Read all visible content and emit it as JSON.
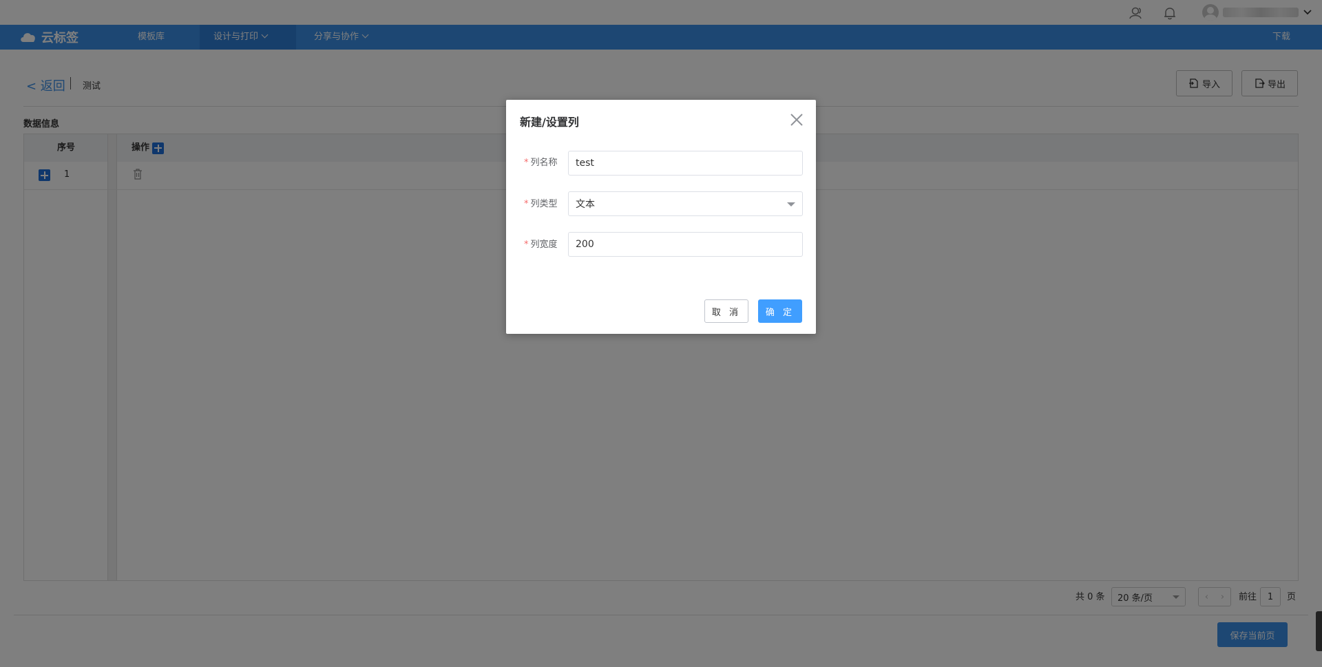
{
  "header": {
    "nav": {
      "brand": "云标签",
      "items": [
        {
          "label": "模板库"
        },
        {
          "label": "设计与打印"
        },
        {
          "label": "分享与协作"
        }
      ],
      "download": "下载"
    }
  },
  "page": {
    "back_label": "< 返回",
    "title": "测试",
    "import_label": "导入",
    "export_label": "导出",
    "section_title": "数据信息"
  },
  "table": {
    "columns": [
      "序号",
      "操作"
    ],
    "rows": [
      {
        "index": "1"
      }
    ]
  },
  "pager": {
    "total": "共 0 条",
    "page_size": "20 条/页",
    "goto_label": "前往",
    "goto_value": "1",
    "page_suffix": "页"
  },
  "footer": {
    "save_label": "保存当前页"
  },
  "dialog": {
    "title": "新建/设置列",
    "fields": [
      {
        "label": "列名称",
        "value": "test"
      },
      {
        "label": "列类型",
        "value": "文本"
      },
      {
        "label": "列宽度",
        "value": "200"
      }
    ],
    "cancel_label": "取 消",
    "ok_label": "确 定"
  },
  "colors": {
    "nav_bg": "#3a8ee6",
    "primary": "#409eff",
    "required": "#f56c6c"
  }
}
